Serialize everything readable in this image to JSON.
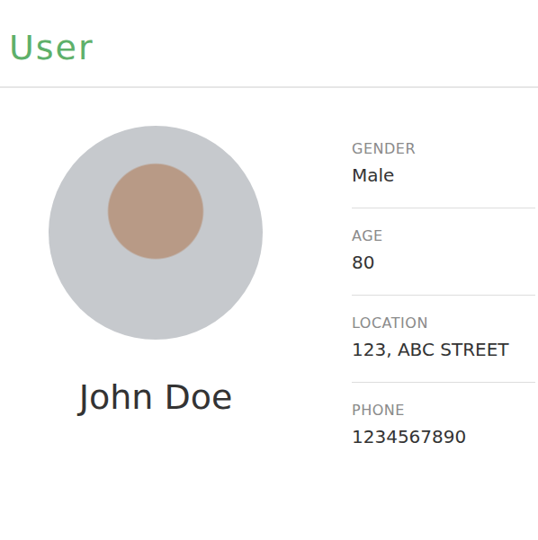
{
  "header": {
    "title": "User"
  },
  "profile": {
    "name": "John Doe"
  },
  "fields": [
    {
      "label": "GENDER",
      "value": "Male"
    },
    {
      "label": "AGE",
      "value": "80"
    },
    {
      "label": "LOCATION",
      "value": "123, ABC STREET"
    },
    {
      "label": "PHONE",
      "value": "1234567890"
    }
  ]
}
